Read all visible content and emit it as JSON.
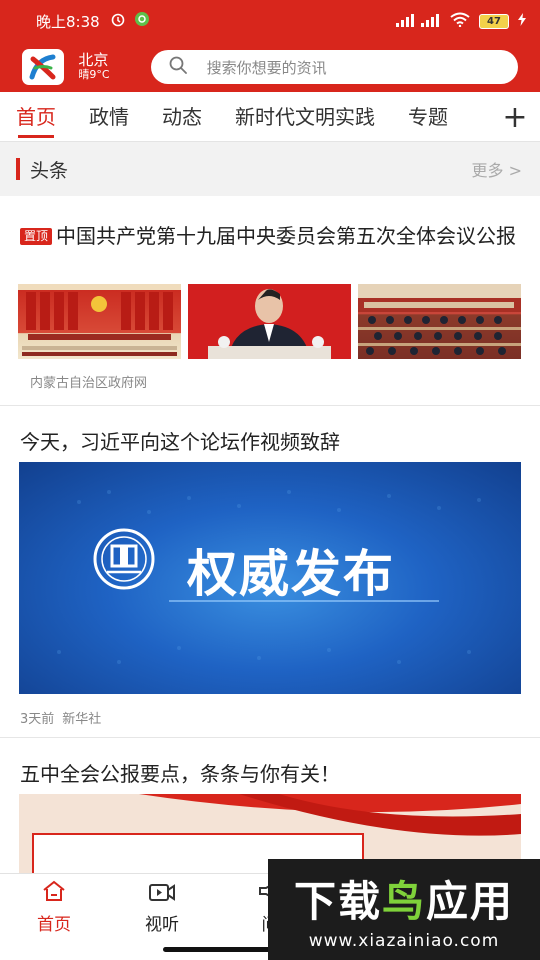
{
  "status_bar": {
    "time": "晚上8:38",
    "signal": "...ıll",
    "battery": "47"
  },
  "header": {
    "city": "北京",
    "weather": "晴9°C",
    "search_placeholder": "搜索你想要的资讯"
  },
  "tabs": [
    {
      "label": "首页",
      "active": true
    },
    {
      "label": "政情",
      "active": false
    },
    {
      "label": "动态",
      "active": false
    },
    {
      "label": "新时代文明实践",
      "active": false
    },
    {
      "label": "专题",
      "active": false
    }
  ],
  "tab_add": "+",
  "section": {
    "title": "头条",
    "more": "更多 >"
  },
  "articles": [
    {
      "tag": "置顶",
      "title": "中国共产党第十九届中央委员会第五次全体会议公报",
      "source": "内蒙古自治区政府网"
    },
    {
      "title": "今天，习近平向这个论坛作视频致辞",
      "banner_text": "权威发布",
      "time": "3天前",
      "source": "新华社"
    },
    {
      "title": "五中全会公报要点，条条与你有关！"
    }
  ],
  "bottom_nav": [
    {
      "label": "首页",
      "icon": "home-icon",
      "active": true
    },
    {
      "label": "视听",
      "icon": "video-icon",
      "active": false
    },
    {
      "label": "问",
      "icon": "megaphone-icon",
      "active": false
    }
  ],
  "watermark": {
    "line1_a": "下载",
    "line1_b": "鸟",
    "line1_c": "应用",
    "line2": "www.xiazainiao.com"
  },
  "colors": {
    "brand_red": "#d8261c",
    "banner_blue": "#1f63c4"
  }
}
